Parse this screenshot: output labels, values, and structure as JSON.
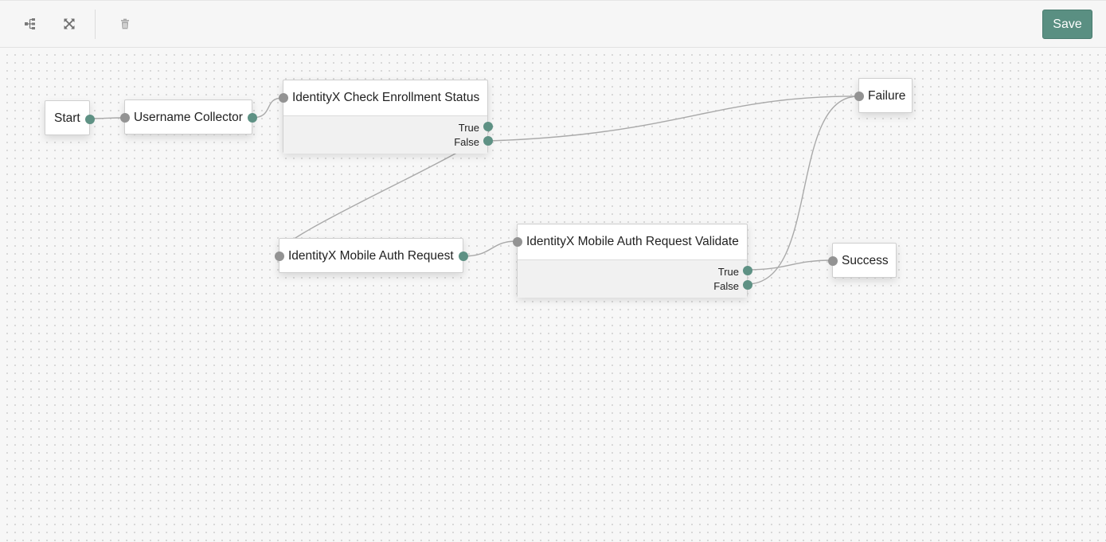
{
  "toolbar": {
    "layout_icon": "tree-layout-icon",
    "fit_icon": "expand-arrows-icon",
    "delete_icon": "trash-icon",
    "save_label": "Save",
    "accent_color": "#5a8f82"
  },
  "nodes": {
    "start": {
      "label": "Start"
    },
    "username_collector": {
      "label": "Username Collector"
    },
    "check_enrollment": {
      "label": "IdentityX Check Enrollment Status",
      "outcomes": [
        "True",
        "False"
      ]
    },
    "mobile_auth_request": {
      "label": "IdentityX Mobile Auth Request"
    },
    "mobile_auth_validate": {
      "label": "IdentityX Mobile Auth Request Validate",
      "outcomes": [
        "True",
        "False"
      ]
    },
    "failure": {
      "label": "Failure"
    },
    "success": {
      "label": "Success"
    }
  },
  "connections": [
    {
      "from": "Start",
      "to": "Username Collector"
    },
    {
      "from": "Username Collector",
      "to": "IdentityX Check Enrollment Status"
    },
    {
      "from": "IdentityX Check Enrollment Status: True",
      "to": "IdentityX Mobile Auth Request"
    },
    {
      "from": "IdentityX Check Enrollment Status: False",
      "to": "Failure"
    },
    {
      "from": "IdentityX Mobile Auth Request",
      "to": "IdentityX Mobile Auth Request Validate"
    },
    {
      "from": "IdentityX Mobile Auth Request Validate: True",
      "to": "Success"
    },
    {
      "from": "IdentityX Mobile Auth Request Validate: False",
      "to": "Failure"
    }
  ]
}
